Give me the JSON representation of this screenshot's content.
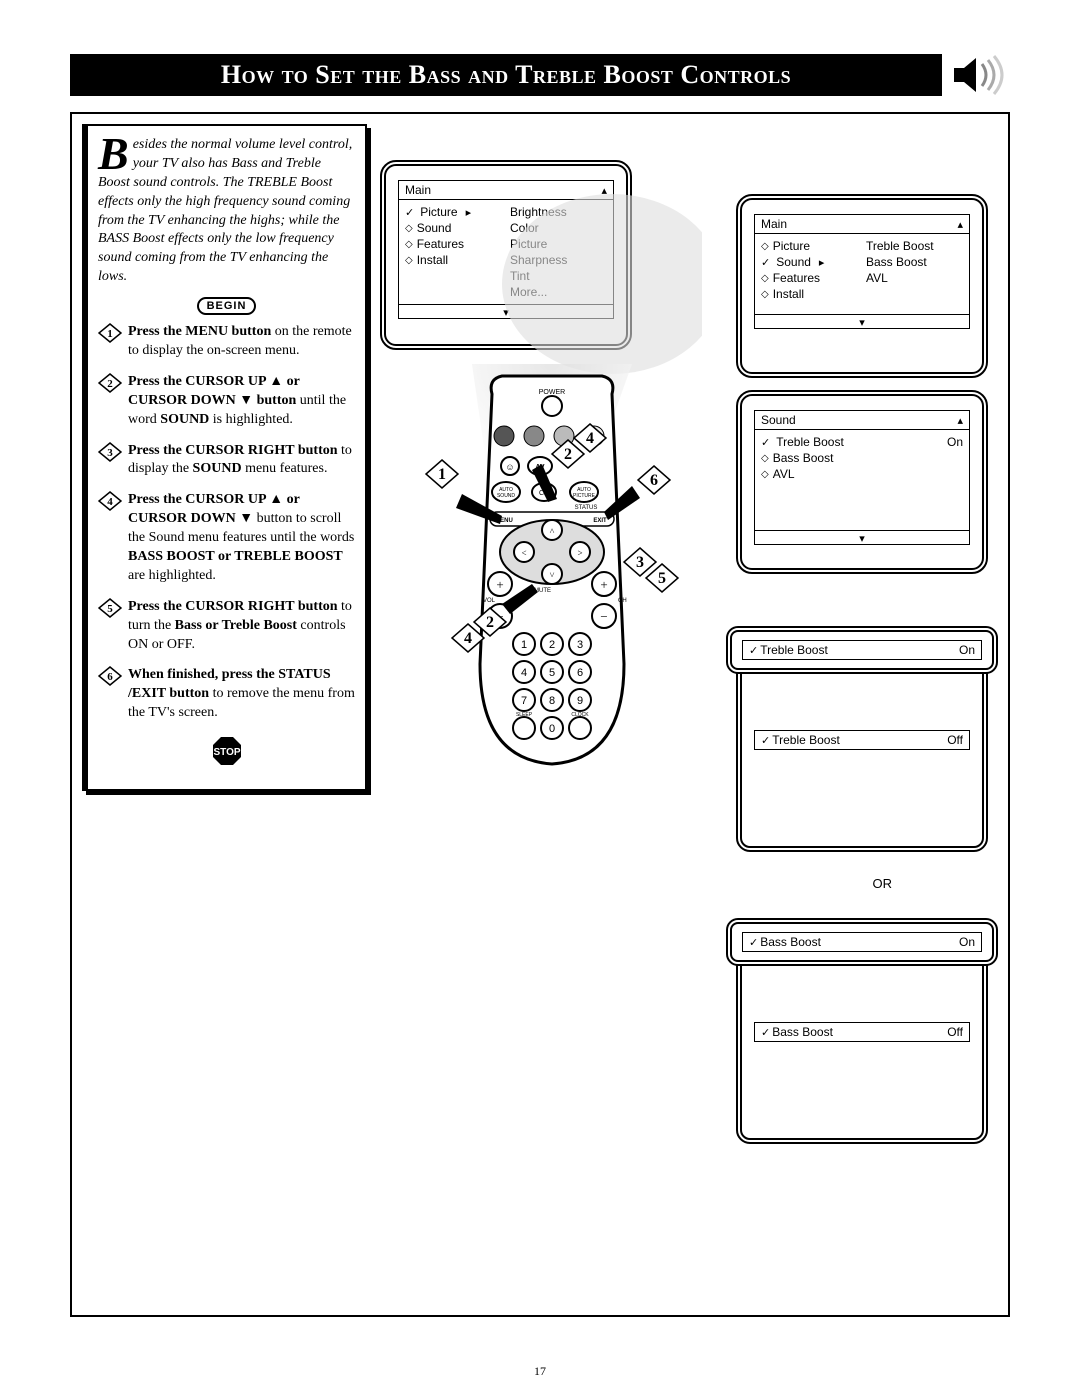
{
  "page_number": "17",
  "title": "How to Set the Bass and Treble Boost Controls",
  "intro": {
    "dropcap": "B",
    "text": "esides the normal volume level control, your TV also has Bass and Treble Boost sound controls. The TREBLE Boost effects only the high frequency sound coming from the TV enhancing the highs; while the BASS Boost effects only the low frequency sound coming from the TV enhancing the lows."
  },
  "begin_label": "BEGIN",
  "stop_label": "STOP",
  "steps": [
    {
      "n": "1",
      "bold": "Press the MENU button",
      "rest": " on the remote to display the on-screen menu."
    },
    {
      "n": "2",
      "bold": "Press the CURSOR UP ▲ or CURSOR DOWN ▼ button",
      "rest": " until the word ",
      "bold2": "SOUND",
      "rest2": " is highlighted."
    },
    {
      "n": "3",
      "bold": "Press the CURSOR RIGHT ",
      "rest": "button",
      "rest_plain": " to display the ",
      "bold2": "SOUND",
      "rest2": " menu features."
    },
    {
      "n": "4",
      "bold": "Press the CURSOR UP ▲ or CURSOR DOWN ▼",
      "rest": " button to scroll the Sound menu features until the words ",
      "bold2": "BASS BOOST or TREBLE BOOST",
      "rest2": " are highlighted."
    },
    {
      "n": "5",
      "bold": "Press the CURSOR RIGHT ",
      "rest": "button",
      "rest_plain": " to turn the ",
      "bold2": "Bass or Treble Boost",
      "rest2": " controls ON or OFF."
    },
    {
      "n": "6",
      "bold": "When finished, press the STATUS /EXIT button",
      "rest": " to remove the menu from the TV's screen."
    }
  ],
  "remote_labels": {
    "power": "POWER",
    "av": "AV",
    "autosound": "AUTO SOUND",
    "cc": "CC",
    "autopicture": "AUTO PICTURE",
    "status": "STATUS",
    "menu": "MENU",
    "exit": "EXIT",
    "mute": "MUTE",
    "vol": "VOL",
    "ch": "CH",
    "sleep": "SLEEP",
    "clock": "CLOCK"
  },
  "callouts_remote": [
    "1",
    "2",
    "4",
    "6",
    "2",
    "4",
    "3",
    "5"
  ],
  "tv_main_picture": {
    "head": "Main",
    "left": [
      {
        "mark": "check",
        "label": "Picture",
        "arrow": true
      },
      {
        "mark": "diamond",
        "label": "Sound"
      },
      {
        "mark": "diamond",
        "label": "Features"
      },
      {
        "mark": "diamond",
        "label": "Install"
      }
    ],
    "right": [
      "Brightness",
      "Color",
      "Picture",
      "Sharpness",
      "Tint",
      "More..."
    ]
  },
  "tv_main_sound": {
    "head": "Main",
    "left": [
      {
        "mark": "diamond",
        "label": "Picture"
      },
      {
        "mark": "check",
        "label": "Sound",
        "arrow": true
      },
      {
        "mark": "diamond",
        "label": "Features"
      },
      {
        "mark": "diamond",
        "label": "Install"
      }
    ],
    "right": [
      "Treble Boost",
      "Bass Boost",
      "AVL"
    ]
  },
  "tv_sound_sub": {
    "head": "Sound",
    "rows": [
      {
        "mark": "check",
        "label": "Treble Boost",
        "value": "On"
      },
      {
        "mark": "diamond",
        "label": "Bass Boost"
      },
      {
        "mark": "diamond",
        "label": "AVL"
      }
    ]
  },
  "strip_treble_on": {
    "label": "Treble Boost",
    "value": "On"
  },
  "strip_treble_off": {
    "label": "Treble Boost",
    "value": "Off"
  },
  "or_label": "OR",
  "strip_bass_on": {
    "label": "Bass Boost",
    "value": "On"
  },
  "strip_bass_off": {
    "label": "Bass Boost",
    "value": "Off"
  }
}
